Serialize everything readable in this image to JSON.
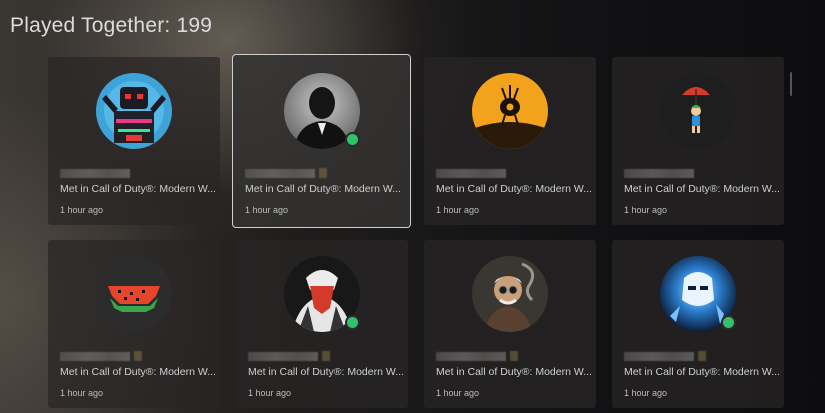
{
  "header": {
    "title": "Played Together: 199"
  },
  "friends": [
    {
      "met": "Met in Call of Duty®: Modern W...",
      "time": "1 hour ago",
      "avatar": "robot-icon",
      "online": false
    },
    {
      "met": "Met in Call of Duty®: Modern W...",
      "time": "1 hour ago",
      "avatar": "man-in-suit-icon",
      "online": true
    },
    {
      "met": "Met in Call of Duty®: Modern W...",
      "time": "1 hour ago",
      "avatar": "sunset-creature-icon",
      "online": false
    },
    {
      "met": "Met in Call of Duty®: Modern W...",
      "time": "1 hour ago",
      "avatar": "umbrella-kid-icon",
      "online": false
    },
    {
      "met": "Met in Call of Duty®: Modern W...",
      "time": "1 hour ago",
      "avatar": "watermelon-icon",
      "online": false
    },
    {
      "met": "Met in Call of Duty®: Modern W...",
      "time": "1 hour ago",
      "avatar": "bandana-skull-icon",
      "online": true
    },
    {
      "met": "Met in Call of Duty®: Modern W...",
      "time": "1 hour ago",
      "avatar": "old-man-icon",
      "online": false
    },
    {
      "met": "Met in Call of Duty®: Modern W...",
      "time": "1 hour ago",
      "avatar": "blue-mask-icon",
      "online": true
    }
  ],
  "colors": {
    "online": "#2fc26a",
    "selected_border": "#cfcfcf"
  }
}
